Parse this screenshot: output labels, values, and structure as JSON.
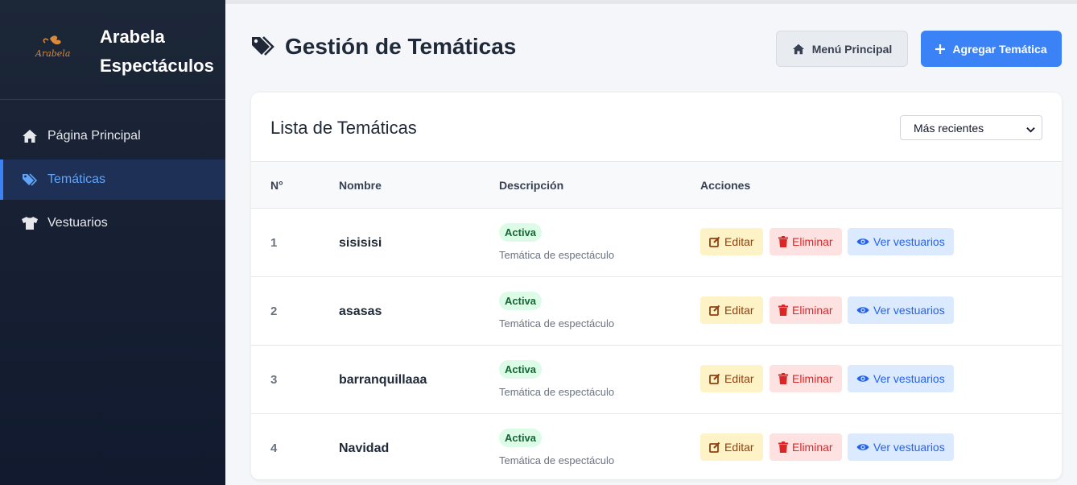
{
  "brand": {
    "logo_text": "Arabela",
    "name": "Arabela Espectáculos"
  },
  "sidebar": {
    "items": [
      {
        "label": "Página Principal",
        "icon": "home-icon"
      },
      {
        "label": "Temáticas",
        "icon": "tags-icon",
        "active": true
      },
      {
        "label": "Vestuarios",
        "icon": "shirt-icon"
      }
    ]
  },
  "header": {
    "title": "Gestión de Temáticas",
    "menu_button": "Menú Principal",
    "add_button": "Agregar Temática"
  },
  "card": {
    "title": "Lista de Temáticas",
    "sort": {
      "selected": "Más recientes"
    }
  },
  "table": {
    "headers": [
      "N°",
      "Nombre",
      "Descripción",
      "Acciones"
    ],
    "rows": [
      {
        "num": "1",
        "name": "sisisisi",
        "status": "Activa",
        "desc": "Temática de espectáculo"
      },
      {
        "num": "2",
        "name": "asasas",
        "status": "Activa",
        "desc": "Temática de espectáculo"
      },
      {
        "num": "3",
        "name": "barranquillaaa",
        "status": "Activa",
        "desc": "Temática de espectáculo"
      },
      {
        "num": "4",
        "name": "Navidad",
        "status": "Activa",
        "desc": "Temática de espectáculo"
      }
    ],
    "actions": {
      "edit": "Editar",
      "delete": "Eliminar",
      "view": "Ver vestuarios"
    }
  },
  "colors": {
    "accent": "#3b82f6",
    "sidebar_bg": "#172033",
    "status_active": "#dcfce7"
  }
}
